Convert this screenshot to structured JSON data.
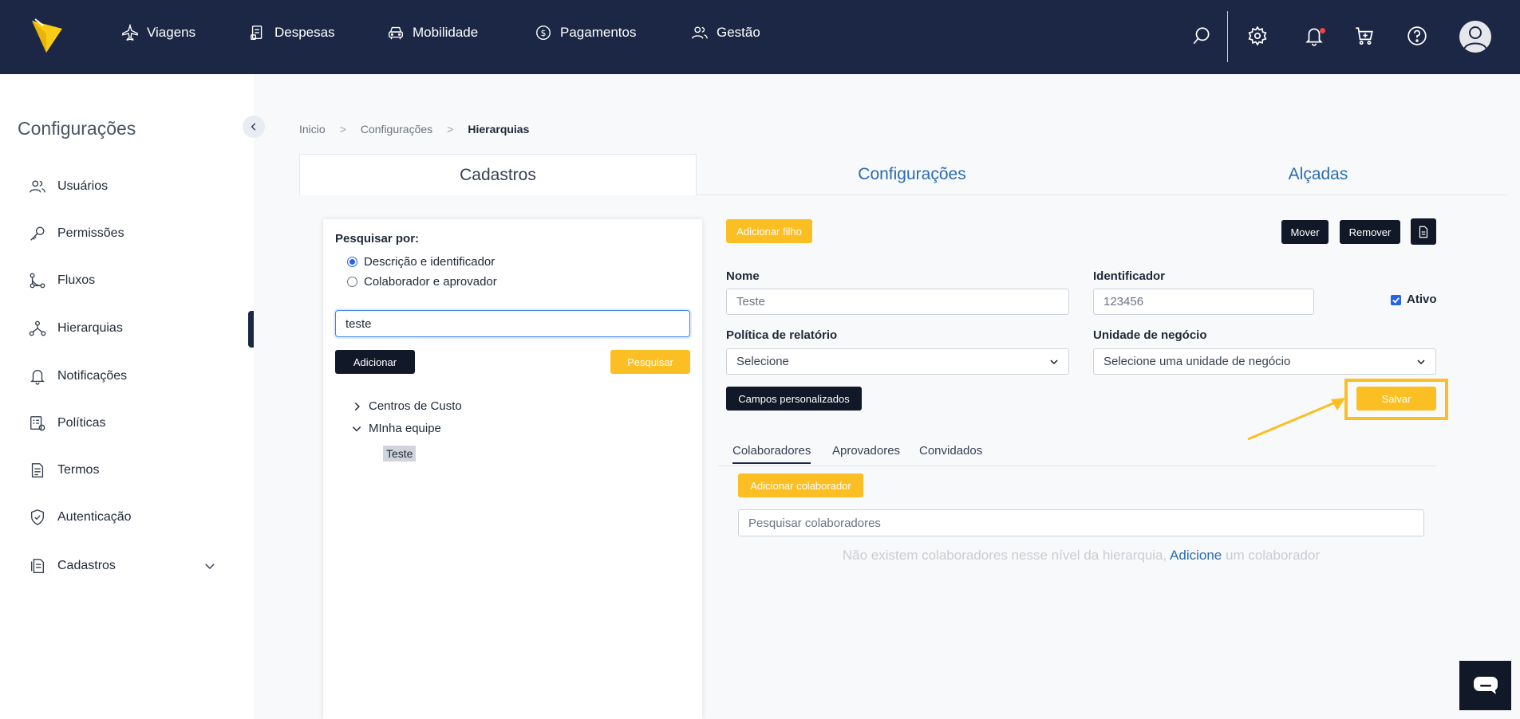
{
  "nav": {
    "items": [
      {
        "label": "Viagens",
        "icon": "plane-icon"
      },
      {
        "label": "Despesas",
        "icon": "receipt-icon"
      },
      {
        "label": "Mobilidade",
        "icon": "car-icon"
      },
      {
        "label": "Pagamentos",
        "icon": "dollar-icon"
      },
      {
        "label": "Gestão",
        "icon": "users-icon"
      }
    ]
  },
  "sidebar": {
    "title": "Configurações",
    "items": [
      {
        "label": "Usuários",
        "icon": "users-icon"
      },
      {
        "label": "Permissões",
        "icon": "key-icon"
      },
      {
        "label": "Fluxos",
        "icon": "flow-icon"
      },
      {
        "label": "Hierarquias",
        "icon": "hierarchy-icon"
      },
      {
        "label": "Notificações",
        "icon": "bell-icon"
      },
      {
        "label": "Políticas",
        "icon": "policy-icon"
      },
      {
        "label": "Termos",
        "icon": "document-icon"
      },
      {
        "label": "Autenticação",
        "icon": "shield-icon"
      },
      {
        "label": "Cadastros",
        "icon": "register-icon"
      }
    ]
  },
  "breadcrumb": {
    "home": "Inicio",
    "section": "Configurações",
    "current": "Hierarquias"
  },
  "tabs": {
    "cadastros": "Cadastros",
    "configuracoes": "Configurações",
    "alcadas": "Alçadas"
  },
  "left_panel": {
    "search_by_label": "Pesquisar por:",
    "radio_desc": "Descrição e identificador",
    "radio_collab": "Colaborador e aprovador",
    "search_value": "teste",
    "add_label": "Adicionar",
    "search_label": "Pesquisar",
    "tree": {
      "cost_centers": "Centros de Custo",
      "my_team": "MInha equipe",
      "leaf": "Teste"
    }
  },
  "form": {
    "add_child": "Adicionar filho",
    "move": "Mover",
    "remove": "Remover",
    "name_label": "Nome",
    "name_value": "Teste",
    "id_label": "Identificador",
    "id_value": "123456",
    "active_label": "Ativo",
    "report_policy_label": "Política de relatório",
    "report_policy_value": "Selecione",
    "business_unit_label": "Unidade de negócio",
    "business_unit_value": "Selecione uma unidade de negócio",
    "custom_fields": "Campos personalizados",
    "save": "Salvar"
  },
  "subtabs": {
    "collaborators": "Colaboradores",
    "approvers": "Aprovadores",
    "guests": "Convidados"
  },
  "collaborators": {
    "add_label": "Adicionar colaborador",
    "search_placeholder": "Pesquisar colaboradores",
    "empty_prefix": "Não existem colaboradores nesse nível da hierarquia,",
    "empty_link": "Adicione",
    "empty_suffix": "um colaborador"
  },
  "colors": {
    "nav_bg": "#1b2745",
    "accent": "#fbbf24",
    "link": "#2b6cb0",
    "dark_button": "#111827"
  }
}
